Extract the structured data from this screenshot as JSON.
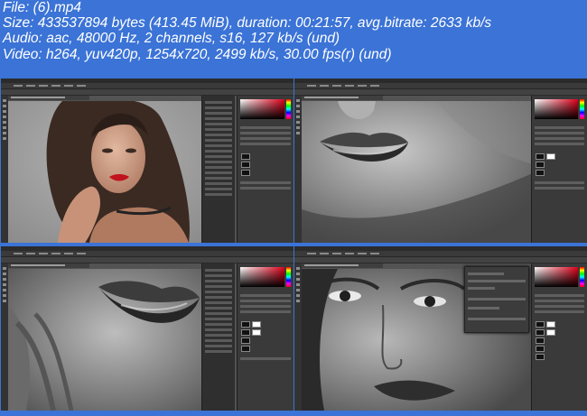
{
  "info": {
    "file": "File:  (6).mp4",
    "size": "Size: 433537894 bytes (413.45 MiB), duration: 00:21:57, avg.bitrate: 2633 kb/s",
    "audio": "Audio: aac, 48000 Hz, 2 channels, s16, 127 kb/s (und)",
    "video": "Video: h264, yuv420p, 1254x720, 2499 kb/s, 30.00 fps(r) (und)"
  },
  "colors": {
    "background": "#3b73d6",
    "ui_dark": "#2f2f2f",
    "ui_mid": "#535353",
    "lip_red": "#c0131f"
  },
  "frames": [
    {
      "app": "Photoshop",
      "subject": "portrait-color"
    },
    {
      "app": "Photoshop",
      "subject": "lips-closeup-bw"
    },
    {
      "app": "Photoshop",
      "subject": "lips-closeup-bw"
    },
    {
      "app": "Photoshop",
      "subject": "eyes-closeup-bw",
      "dialog_open": true
    }
  ]
}
